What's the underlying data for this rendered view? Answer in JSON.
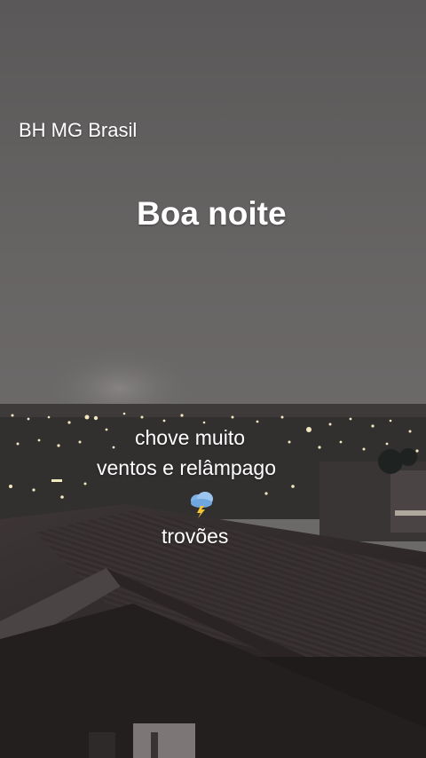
{
  "overlay": {
    "location": "BH MG Brasil",
    "greeting": "Boa noite",
    "lines": [
      "chove muito",
      "ventos e relâmpago",
      "trovões"
    ],
    "emoji_icon": "storm-cloud-lightning-icon"
  },
  "colors": {
    "sky": "#6e6b6b",
    "text": "#ffffff",
    "city_lights": "#f3e7c0",
    "roof": "#2f2a2a"
  }
}
